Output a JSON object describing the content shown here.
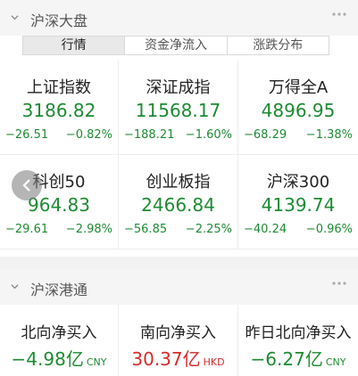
{
  "section1": {
    "title": "沪深大盘"
  },
  "tabs": [
    "行情",
    "资金净流入",
    "涨跌分布"
  ],
  "indices": [
    {
      "name": "上证指数",
      "value": "3186.82",
      "change": "−26.51",
      "pct": "−0.82%"
    },
    {
      "name": "深证成指",
      "value": "11568.17",
      "change": "−188.21",
      "pct": "−1.60%"
    },
    {
      "name": "万得全A",
      "value": "4896.95",
      "change": "−68.29",
      "pct": "−1.38%"
    },
    {
      "name": "科创50",
      "value": "964.83",
      "change": "−29.61",
      "pct": "−2.98%"
    },
    {
      "name": "创业板指",
      "value": "2466.84",
      "change": "−56.85",
      "pct": "−2.25%"
    },
    {
      "name": "沪深300",
      "value": "4139.74",
      "change": "−40.24",
      "pct": "−0.96%"
    }
  ],
  "section2": {
    "title": "沪深港通"
  },
  "flows": [
    {
      "name": "北向净买入",
      "value": "−4.98亿",
      "unit": "CNY",
      "color": "#1e8b33"
    },
    {
      "name": "南向净买入",
      "value": "30.37亿",
      "unit": "HKD",
      "color": "#d72a2a"
    },
    {
      "name": "昨日北向净买入",
      "value": "−6.27亿",
      "unit": "CNY",
      "color": "#1e8b33"
    }
  ],
  "icons": {
    "collapse": "chevron-down-icon",
    "more": "more-dots-icon",
    "back": "chevron-left-icon"
  }
}
